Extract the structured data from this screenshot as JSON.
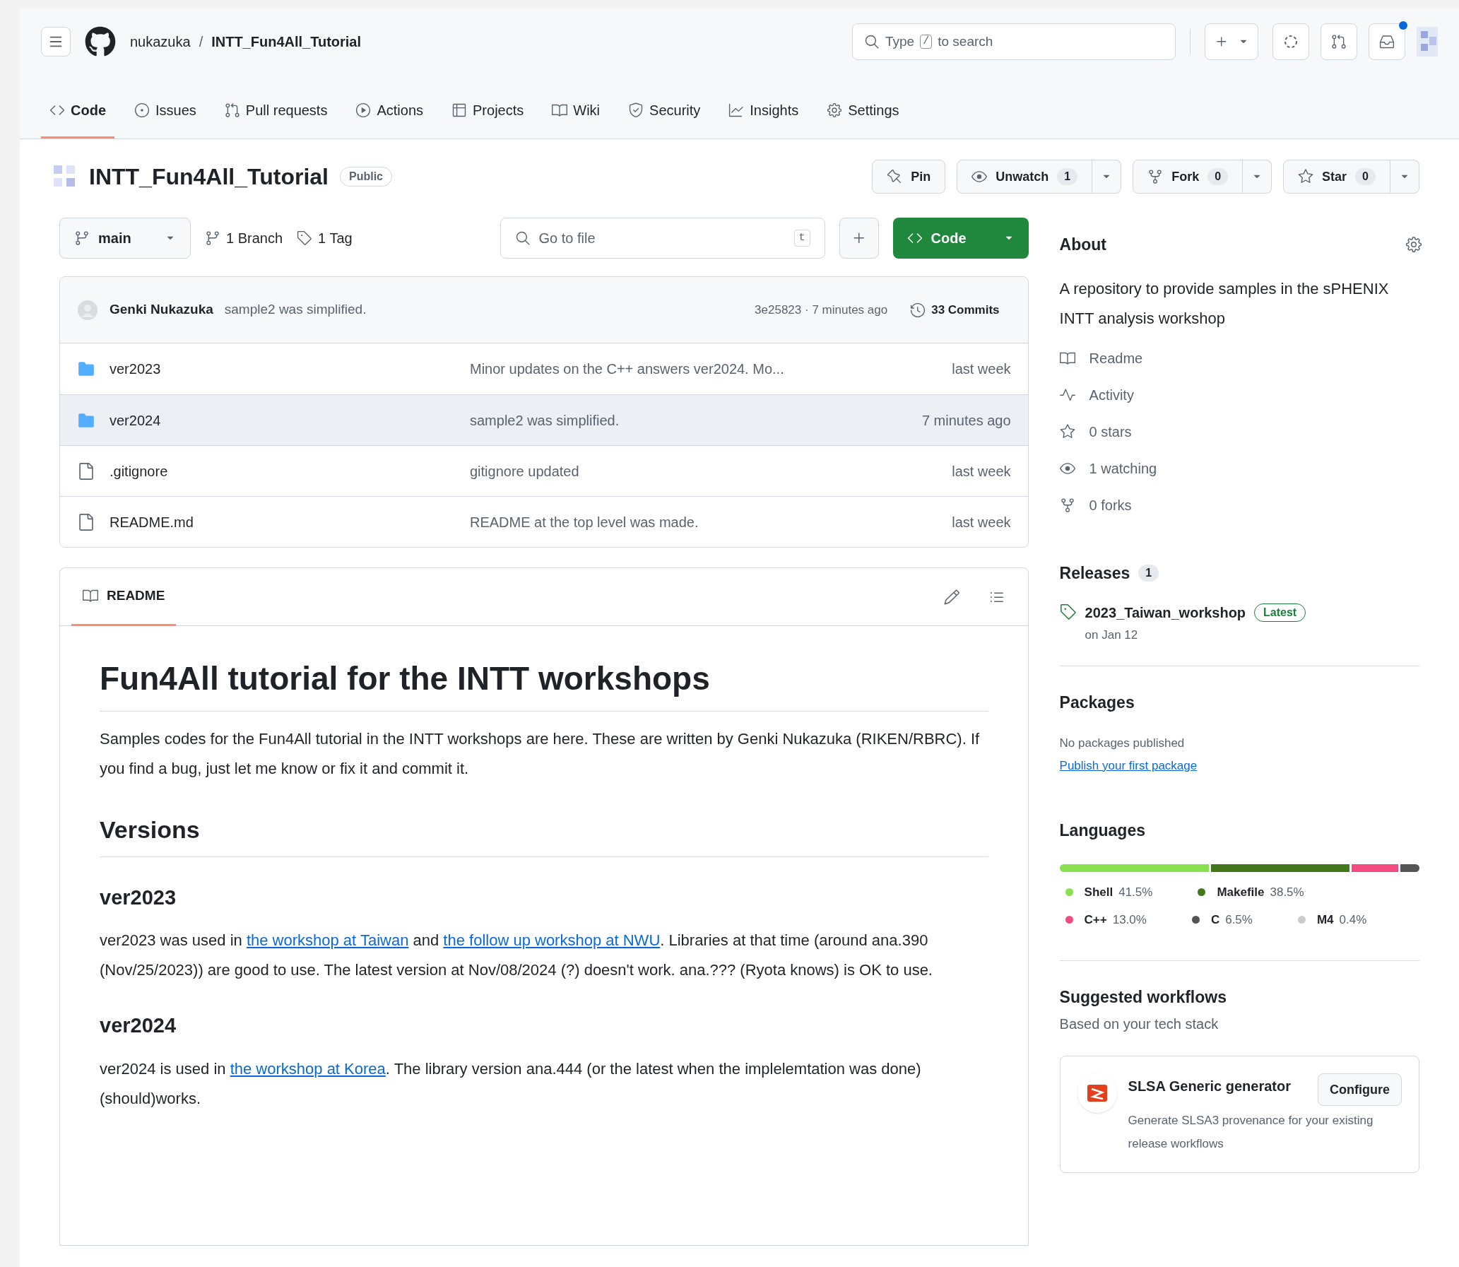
{
  "header": {
    "owner": "nukazuka",
    "separator": "/",
    "repo": "INTT_Fun4All_Tutorial",
    "search": {
      "placeholder": "Type",
      "key": "/",
      "suffix": "to search"
    },
    "inbox_unread": true
  },
  "tabs": [
    {
      "label": "Code",
      "selected": true
    },
    {
      "label": "Issues",
      "selected": false
    },
    {
      "label": "Pull requests",
      "selected": false
    },
    {
      "label": "Actions",
      "selected": false
    },
    {
      "label": "Projects",
      "selected": false
    },
    {
      "label": "Wiki",
      "selected": false
    },
    {
      "label": "Security",
      "selected": false
    },
    {
      "label": "Insights",
      "selected": false
    },
    {
      "label": "Settings",
      "selected": false
    }
  ],
  "repo": {
    "title": "INTT_Fun4All_Tutorial",
    "visibility": "Public",
    "actions": [
      {
        "label": "Pin"
      },
      {
        "label": "Unwatch",
        "count": "1"
      },
      {
        "label": "Fork",
        "count": "0"
      },
      {
        "label": "Star",
        "count": "0"
      }
    ]
  },
  "toolbar": {
    "branch": "main",
    "branches": "1 Branch",
    "tags": "1 Tag",
    "go_to_file": {
      "placeholder": "Go to file",
      "key": "t"
    },
    "code_button": "Code"
  },
  "commit": {
    "author": "Genki Nukazuka",
    "message": "sample2 was simplified.",
    "meta": "3e25823 · 7 minutes ago",
    "commits": "33 Commits"
  },
  "files": [
    {
      "kind": "folder",
      "name": "ver2023",
      "message": "Minor updates on the C++ answers ver2024. Mo...",
      "time": "last week",
      "selected": false
    },
    {
      "kind": "folder",
      "name": "ver2024",
      "message": "sample2 was simplified.",
      "time": "7 minutes ago",
      "selected": true
    },
    {
      "kind": "file",
      "name": ".gitignore",
      "message": "gitignore updated",
      "time": "last week",
      "selected": false
    },
    {
      "kind": "file",
      "name": "README.md",
      "message": "README at the top level was made.",
      "time": "last week",
      "selected": false
    }
  ],
  "readme": {
    "tab": "README",
    "title": "Fun4All tutorial for the INTT workshops",
    "blocks": [
      {
        "kind": "p",
        "parts": [
          {
            "kind": "text",
            "text": "Samples codes for the Fun4All tutorial in the INTT workshops are here. These are written by Genki Nukazuka (RIKEN/RBRC). If you find a bug, just let me know or fix it and commit it."
          }
        ]
      },
      {
        "kind": "h2",
        "text": "Versions"
      },
      {
        "kind": "h3",
        "text": "ver2023"
      },
      {
        "kind": "p",
        "parts": [
          {
            "kind": "text",
            "text": "ver2023 was used in "
          },
          {
            "kind": "link",
            "text": "the workshop at Taiwan"
          },
          {
            "kind": "text",
            "text": " and "
          },
          {
            "kind": "link",
            "text": "the follow up workshop at NWU"
          },
          {
            "kind": "text",
            "text": ". Libraries at that time (around ana.390 (Nov/25/2023)) are good to use. The latest version at Nov/08/2024 (?) doesn't work. ana.??? (Ryota knows) is OK to use."
          }
        ]
      },
      {
        "kind": "h3",
        "text": "ver2024"
      },
      {
        "kind": "p",
        "parts": [
          {
            "kind": "text",
            "text": "ver2024 is used in "
          },
          {
            "kind": "link",
            "text": "the workshop at Korea"
          },
          {
            "kind": "text",
            "text": ". The library version ana.444 (or the latest when the implelemtation was done) (should)works."
          }
        ]
      }
    ]
  },
  "about": {
    "title": "About",
    "description": "A repository to provide samples in the sPHENIX INTT analysis workshop",
    "links": [
      "Readme",
      "Activity",
      "0 stars",
      "1 watching",
      "0 forks"
    ]
  },
  "releases": {
    "title": "Releases",
    "count": "1",
    "name": "2023_Taiwan_workshop",
    "badge": "Latest",
    "date": "on Jan 12"
  },
  "packages": {
    "title": "Packages",
    "note": "No packages published",
    "link": "Publish your first package"
  },
  "languages": {
    "title": "Languages",
    "items": [
      {
        "name": "Shell",
        "percent": "41.5%",
        "color": "#89e051"
      },
      {
        "name": "Makefile",
        "percent": "38.5%",
        "color": "#427819"
      },
      {
        "name": "C++",
        "percent": "13.0%",
        "color": "#f34b7d"
      },
      {
        "name": "C",
        "percent": "6.5%",
        "color": "#555555"
      },
      {
        "name": "M4",
        "percent": "0.4%",
        "color": "#cccccc"
      }
    ]
  },
  "workflows": {
    "title": "Suggested workflows",
    "subtitle": "Based on your tech stack",
    "card": {
      "name": "SLSA Generic generator",
      "description": "Generate SLSA3 provenance for your existing release workflows",
      "button": "Configure"
    }
  }
}
